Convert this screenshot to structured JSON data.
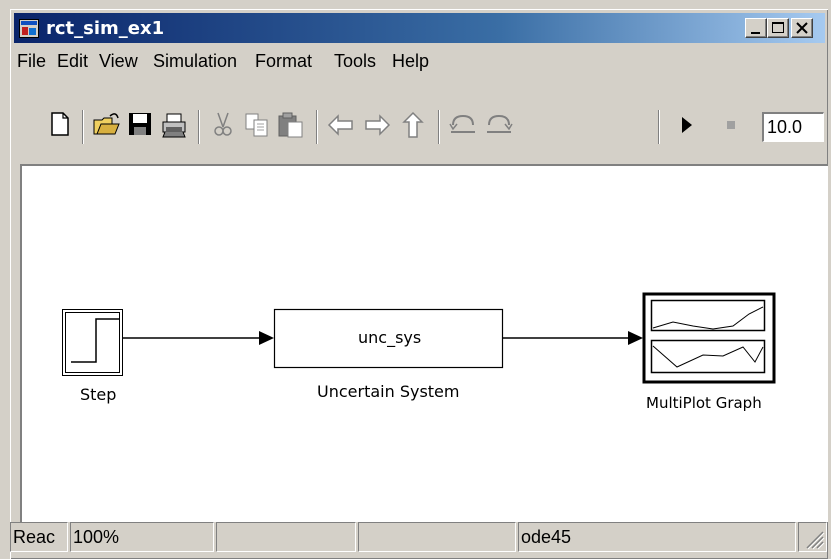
{
  "window": {
    "title": "rct_sim_ex1"
  },
  "menu": [
    "File",
    "Edit",
    "View",
    "Simulation",
    "Format",
    "Tools",
    "Help"
  ],
  "toolbar": {
    "icons": [
      "new-model-icon",
      "open-icon",
      "save-icon",
      "print-icon",
      "cut-icon",
      "copy-icon",
      "paste-icon",
      "back-icon",
      "forward-icon",
      "up-icon",
      "undo-icon",
      "redo-icon",
      "start-simulation-icon",
      "stop-simulation-icon"
    ],
    "stop_time": "10.0"
  },
  "diagram": {
    "blocks": [
      {
        "name": "step",
        "label": "Step"
      },
      {
        "name": "uncertain-system",
        "content": "unc_sys",
        "label": "Uncertain System"
      },
      {
        "name": "multiplot-graph",
        "label": "MultiPlot Graph"
      }
    ]
  },
  "status": {
    "state": "Reac",
    "zoom": "100%",
    "cell3": "",
    "cell4": "",
    "solver": "ode45",
    "cell6": ""
  }
}
